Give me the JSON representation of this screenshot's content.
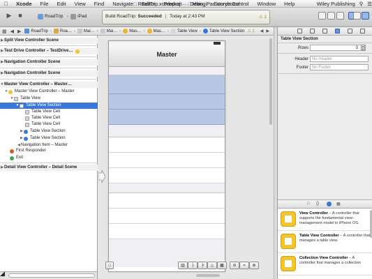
{
  "menubar": {
    "items": [
      "Xcode",
      "File",
      "Edit",
      "View",
      "Find",
      "Navigate",
      "Editor",
      "Product",
      "Debug",
      "Source Control",
      "Window",
      "Help"
    ],
    "user": "Wiley Publishing"
  },
  "toolbar": {
    "scheme": "RoadTrip",
    "device": "iPad",
    "window_title": "RoadTrip.xcodeproj",
    "file_title": "Main_iPad.storyboard",
    "status_prefix": "Build RoadTrip: ",
    "status_result": "Succeeded",
    "status_time": "Today at 2:43 PM",
    "warning_count": "1"
  },
  "jumpbar": {
    "crumbs": [
      "RoadTrip",
      "Roa…",
      "Mai…",
      "Mai…",
      "Mas…",
      "Mas…",
      "Table View",
      "Table View Section"
    ],
    "warning_count": "1"
  },
  "outline": {
    "rows": [
      {
        "label": "Split View Controller Scene",
        "kind": "scene"
      },
      {
        "label": "Test Drive Controller – TestDrive…",
        "kind": "scene"
      },
      {
        "label": "Navigation Controller Scene",
        "kind": "scene"
      },
      {
        "label": "Navigation Controller Scene",
        "kind": "scene"
      },
      {
        "label": "Master View Controller – Master…",
        "kind": "scene"
      },
      {
        "label": "Master View Controller – Master",
        "kind": "item"
      },
      {
        "label": "Table View",
        "kind": "item"
      },
      {
        "label": "Table View Section",
        "kind": "selected"
      },
      {
        "label": "Table View Cell",
        "kind": "item"
      },
      {
        "label": "Table View Cell",
        "kind": "item"
      },
      {
        "label": "Table View Cell",
        "kind": "item"
      },
      {
        "label": "Table View Section",
        "kind": "item"
      },
      {
        "label": "Table View Section",
        "kind": "item"
      },
      {
        "label": "Navigation Item – Master",
        "kind": "item"
      },
      {
        "label": "First Responder",
        "kind": "item"
      },
      {
        "label": "Exit",
        "kind": "item"
      },
      {
        "label": "Detail View Controller – Detail Scene",
        "kind": "scene"
      }
    ]
  },
  "canvas": {
    "nav_title": "Master"
  },
  "inspector": {
    "section_title": "Table View Section",
    "rows_label": "Rows",
    "rows_value": "3",
    "header_label": "Header",
    "header_placeholder": "No Header",
    "footer_label": "Footer",
    "footer_placeholder": "No Footer"
  },
  "library": {
    "items": [
      {
        "title": "View Controller",
        "desc": " – A controller that supports the fundamental view-management model in iPhone OS."
      },
      {
        "title": "Table View Controller",
        "desc": " – A controller that manages a table view."
      },
      {
        "title": "Collection View Controller",
        "desc": " – A controller that manages a collection"
      }
    ]
  },
  "colors": {
    "selection": "#3b78d6",
    "section_highlight": "#b8c7e6",
    "status_success": "#222222",
    "library_icon": "#f2c42d"
  }
}
